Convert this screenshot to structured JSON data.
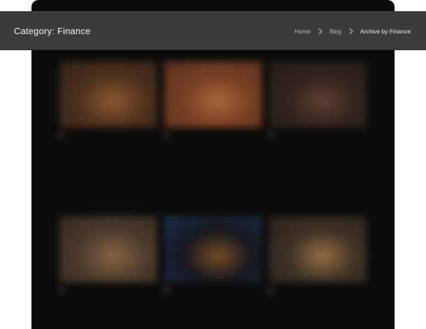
{
  "header": {
    "title": "Category: Finance",
    "breadcrumb": [
      {
        "label": "Home"
      },
      {
        "label": "Blog"
      },
      {
        "label": "Archive by Finance"
      }
    ]
  },
  "cards": [
    {
      "title": "",
      "meta": "",
      "colors": [
        "#5a3a22",
        "#a8663a",
        "#3a2416"
      ]
    },
    {
      "title": "",
      "meta": "",
      "colors": [
        "#8a4a2a",
        "#c57a45",
        "#6a3520"
      ]
    },
    {
      "title": "",
      "meta": "",
      "colors": [
        "#3a2a22",
        "#6e4a38",
        "#2a1e18"
      ]
    },
    {
      "title": "",
      "meta": "",
      "colors": [
        "#5a4634",
        "#a07650",
        "#3a2c20"
      ]
    },
    {
      "title": "",
      "meta": "",
      "colors": [
        "#1a1a24",
        "#8a5a2a",
        "#1e3a5a"
      ]
    },
    {
      "title": "",
      "meta": "",
      "colors": [
        "#4a3a2c",
        "#b08050",
        "#2e241c"
      ]
    }
  ]
}
